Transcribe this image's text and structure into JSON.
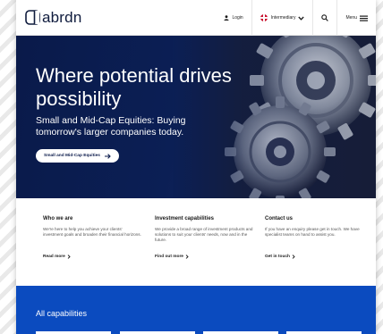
{
  "header": {
    "logo_text": "abrdn",
    "nav": {
      "login": "Login",
      "audience": "Intermediary",
      "menu": "Menu"
    }
  },
  "hero": {
    "title": "Where potential drives possibility",
    "subtitle": "Small and Mid-Cap Equities: Buying tomorrow's larger companies today.",
    "cta_label": "Small and Mid-Cap Equities"
  },
  "columns": [
    {
      "heading": "Who we are",
      "body": "We're here to help you achieve your clients' investment goals and broaden their financial horizons.",
      "link": "Read more"
    },
    {
      "heading": "Investment capabilities",
      "body": "We provide a broad range of investment products and solutions to suit your clients' needs, now and in the future.",
      "link": "Find out more"
    },
    {
      "heading": "Contact us",
      "body": "If you have an enquiry please get in touch. We have specialist teams on hand to assist you.",
      "link": "Get in touch"
    }
  ],
  "capabilities": {
    "heading": "All capabilities",
    "card_count": 4
  },
  "colors": {
    "brand_navy": "#0a1a4a",
    "capabilities_blue": "#0b4bbf",
    "flag_red": "#c8102e"
  },
  "icons": [
    "logo-mark-icon",
    "user-icon",
    "flag-icon",
    "chevron-down-icon",
    "search-icon",
    "hamburger-menu-icon",
    "arrow-right-icon",
    "chevron-right-icon"
  ]
}
